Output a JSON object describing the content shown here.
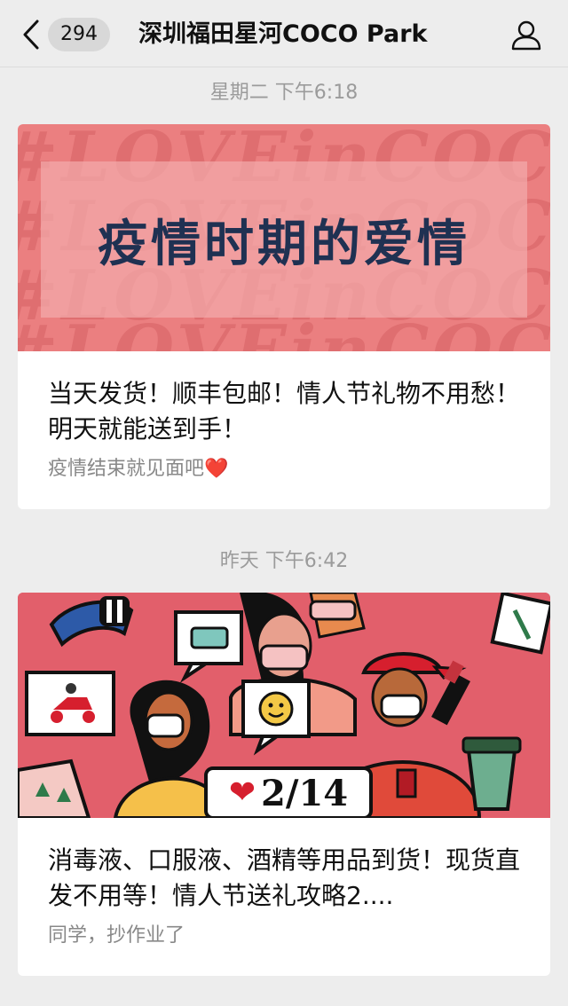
{
  "header": {
    "unread_count": "294",
    "title": "深圳福田星河COCO Park"
  },
  "messages": [
    {
      "timestamp": "星期二 下午6:18",
      "banner_watermark": "#LOVEinCOCO",
      "banner_text": "疫情时期的爱情",
      "headline": "当天发货！顺丰包邮！情人节礼物不用愁！明天就能送到手！",
      "subline": "疫情结束就见面吧",
      "subline_emoji": "❤️"
    },
    {
      "timestamp": "昨天 下午6:42",
      "banner_heart": "❤",
      "banner_date": "2/14",
      "headline": "消毒液、口服液、酒精等用品到货！现货直发不用等！情人节送礼攻略2....",
      "subline": "同学，抄作业了"
    }
  ],
  "colors": {
    "background": "#ededed",
    "banner1": "#eb7f80",
    "banner1_text": "#1f3152",
    "banner2": "#e25f6b"
  }
}
